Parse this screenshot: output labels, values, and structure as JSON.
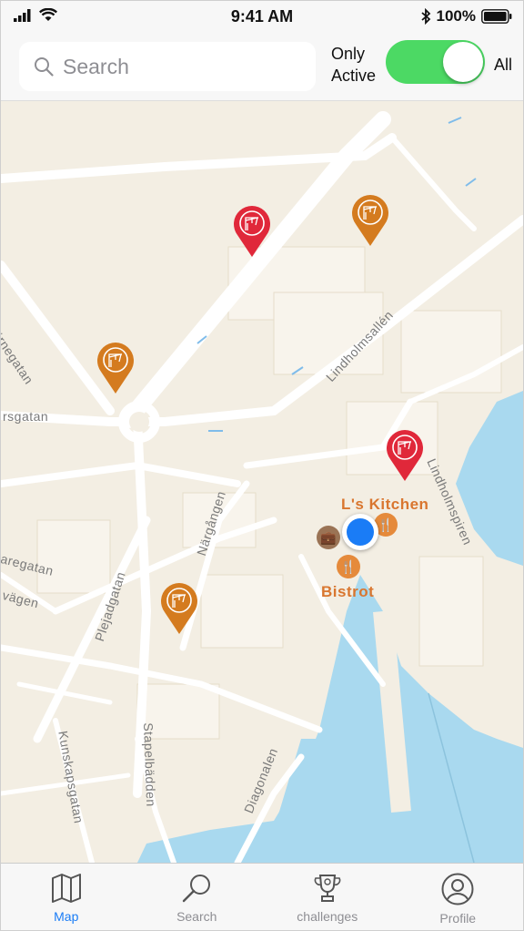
{
  "status_bar": {
    "time": "9:41 AM",
    "battery_percent": "100%",
    "icons": [
      "signal-icon",
      "wifi-icon",
      "bluetooth-icon",
      "battery-icon"
    ]
  },
  "header": {
    "search_placeholder": "Search",
    "toggle_left_label_line1": "Only",
    "toggle_left_label_line2": "Active",
    "toggle_right_label": "All",
    "toggle_on": true,
    "toggle_color": "#4cd964"
  },
  "map": {
    "streets": {
      "s1": "olstjärnegatan",
      "s2": "Lindholmsallén",
      "s3": "rsgatan",
      "s4": "Lindholmspiren",
      "s5": "Närgången",
      "s6": "aregatan",
      "s7": "vägen",
      "s8": "Plejadgatan",
      "s9": "Kunskapsgatan",
      "s10": "Stapelbädden",
      "s11": "Diagonalen"
    },
    "pois": {
      "kitchen": "L's Kitchen",
      "bistrot": "Bistrot"
    },
    "pin_colors": {
      "red": "#e0283a",
      "orange": "#d47b1f"
    },
    "markers": [
      {
        "id": "marker-red-1",
        "color": "red",
        "icon": "crane-icon"
      },
      {
        "id": "marker-orange-1",
        "color": "orange",
        "icon": "crane-icon"
      },
      {
        "id": "marker-orange-2",
        "color": "orange",
        "icon": "crane-icon"
      },
      {
        "id": "marker-red-2",
        "color": "red",
        "icon": "crane-icon"
      },
      {
        "id": "marker-orange-3",
        "color": "orange",
        "icon": "crane-icon"
      }
    ]
  },
  "tabs": {
    "map": "Map",
    "search": "Search",
    "challenges": "challenges",
    "profile": "Profile",
    "active": "map",
    "accent": "#1a7cf6"
  }
}
